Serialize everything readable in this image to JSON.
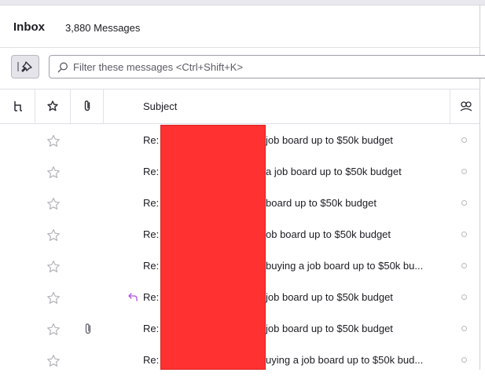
{
  "header": {
    "title": "Inbox",
    "count": "3,880 Messages"
  },
  "filter": {
    "placeholder": "Filter these messages <Ctrl+Shift+K>"
  },
  "columns": {
    "subject": "Subject"
  },
  "colors": {
    "accent_reply": "#b24ee8",
    "redaction": "#ff3131"
  },
  "icons": [
    "thread-icon",
    "star-icon",
    "attachment-icon",
    "pin-icon",
    "search-icon",
    "correspondents-icon",
    "reply-icon",
    "read-status-icon"
  ],
  "messages": [
    {
      "prefix": "Re:",
      "subject": "job board up to $50k budget",
      "attachment": false,
      "replied": false
    },
    {
      "prefix": "Re:",
      "subject": "a job board up to $50k budget",
      "attachment": false,
      "replied": false
    },
    {
      "prefix": "Re:",
      "subject": "board up to $50k budget",
      "attachment": false,
      "replied": false
    },
    {
      "prefix": "Re:",
      "subject": "ob board up to $50k budget",
      "attachment": false,
      "replied": false
    },
    {
      "prefix": "Re:",
      "subject": "buying a job board up to $50k bu...",
      "attachment": false,
      "replied": false
    },
    {
      "prefix": "Re:",
      "subject": "job board up to $50k budget",
      "attachment": false,
      "replied": true
    },
    {
      "prefix": "Re:",
      "subject": "job board up to $50k budget",
      "attachment": true,
      "replied": false
    },
    {
      "prefix": "Re:",
      "subject": "uying a job board up to $50k bud...",
      "attachment": false,
      "replied": false
    }
  ]
}
